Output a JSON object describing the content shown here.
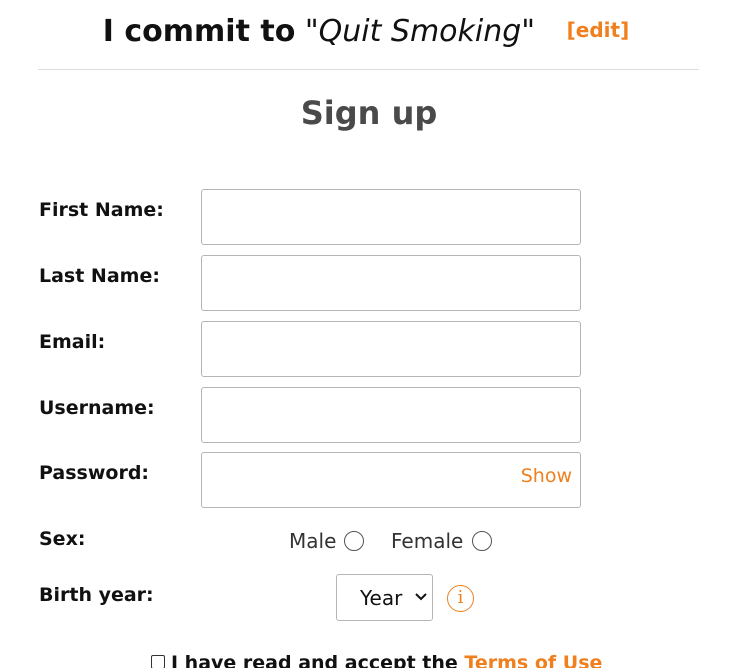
{
  "header": {
    "commit_prefix": "I commit to",
    "goal": "\"Quit Smoking\"",
    "edit_label": "[edit]"
  },
  "form": {
    "title": "Sign up",
    "fields": [
      {
        "label": "First Name:",
        "value": ""
      },
      {
        "label": "Last Name:",
        "value": ""
      },
      {
        "label": "Email:",
        "value": ""
      },
      {
        "label": "Username:",
        "value": ""
      },
      {
        "label": "Password:",
        "value": "",
        "toggle_label": "Show"
      }
    ],
    "sex": {
      "label": "Sex:",
      "options": [
        "Male",
        "Female"
      ],
      "selected": null
    },
    "birth_year": {
      "label": "Birth year:",
      "selected": "Year",
      "info_icon": "i"
    },
    "terms": {
      "text": "I have read and accept the ",
      "link_text": "Terms of Use",
      "checked": false
    }
  },
  "colors": {
    "accent": "#f07f1e",
    "title": "#4a4a4a",
    "border": "#b5b5b5"
  }
}
